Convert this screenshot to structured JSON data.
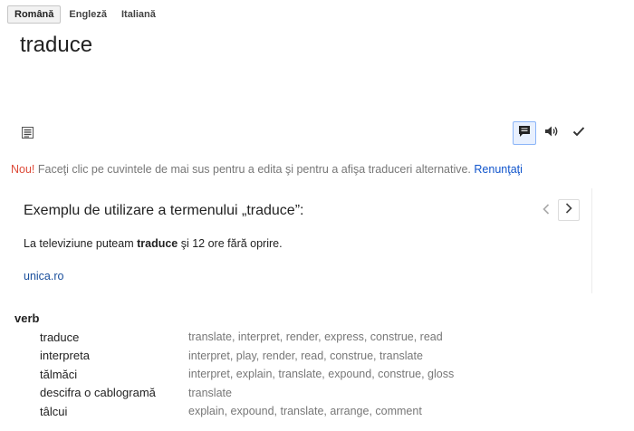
{
  "languages": {
    "tabs": [
      {
        "label": "Română",
        "active": true
      },
      {
        "label": "Engleză",
        "active": false
      },
      {
        "label": "Italiană",
        "active": false
      }
    ]
  },
  "source": {
    "text": "traduce"
  },
  "toolbar": {
    "icons": [
      "document-icon",
      "chat-bubble-icon",
      "speaker-icon",
      "checkmark-icon"
    ],
    "accent_color": "#1a73e8"
  },
  "notice": {
    "new_label": "Nou!",
    "message": " Faceţi clic pe cuvintele de mai sus pentru a edita şi pentru a afişa traduceri alternative. ",
    "dismiss_label": "Renunţaţi",
    "new_color": "#dd4b39",
    "link_color": "#1155cc"
  },
  "example": {
    "title": "Exemplu de utilizare a termenului „traduce”:",
    "sentence_before": "La televiziune puteam ",
    "sentence_bold": "traduce",
    "sentence_after": " şi 12 ore fără oprire.",
    "source": "unica.ro"
  },
  "dictionary": {
    "part_of_speech": "verb",
    "entries": [
      {
        "word": "traduce",
        "translations": "translate, interpret, render, express, construe, read"
      },
      {
        "word": "interpreta",
        "translations": "interpret, play, render, read, construe, translate"
      },
      {
        "word": "tălmăci",
        "translations": "interpret, explain, translate, expound, construe, gloss"
      },
      {
        "word": "descifra o cablogramă",
        "translations": "translate"
      },
      {
        "word": "tâlcui",
        "translations": "explain, expound, translate, arrange, comment"
      }
    ]
  }
}
